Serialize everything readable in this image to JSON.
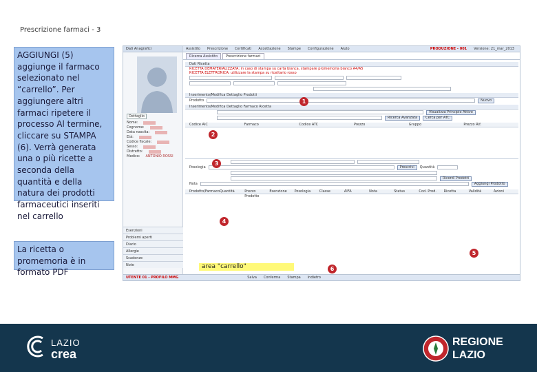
{
  "slide": {
    "title": "Prescrizione farmaci - 3"
  },
  "notes": {
    "main": "AGGIUNGI (5) aggiunge il farmaco selezionato nel “carrello”. Per aggiungere altri farmaci ripetere il processo Al termine, cliccare su STAMPA (6). Verrà generata una o più ricette a seconda della quantità e della natura dei prodotti farmaceutici inseriti nel carrello",
    "secondary": "La ricetta o promemoria è in formato PDF"
  },
  "app": {
    "left_header": "Dati Anagrafici",
    "photo_label": "Dettaglio",
    "patient_fields": [
      "Nome:",
      "Cognome:",
      "Data nascita:",
      "Età:",
      "Codice fiscale:",
      "Sesso:",
      "Distretto:",
      "Medico:"
    ],
    "medico_value": "ANTONIO ROSSI",
    "accordion": [
      "Esenzioni",
      "Problemi aperti",
      "Diario",
      "Allergie",
      "Scadenze",
      "Note"
    ],
    "topbar": {
      "items": [
        "Assistito",
        "Prescrizione",
        "Certificati",
        "Accettazione",
        "Stampe",
        "Configurazione",
        "Aiuto"
      ],
      "env": "PRODUZIONE - 001",
      "version": "Versione: 21_mar_2013"
    },
    "tabs": [
      "Ricerca Assistito",
      "Prescrizione farmaci"
    ],
    "sections": {
      "ricetta": "Dati Ricetta",
      "warn1": "RICETTA DEMATERIALIZZATA: in caso di stampa su carta bianca, stampare promemoria bianco A4/A5",
      "warn2": "RICETTA ELETTRONICA: utilizzare la stampa su ricettario rosso",
      "inserimento": "Inserimento/Modifica Dettaglio Prodotti",
      "farmaco": "Inserimento/Modifica Dettaglio Farmaco Ricetta",
      "campo_prodotto": "Prodotto",
      "btn_nuovo": "Nuovo",
      "btn_pa": "Visualizza Principio Attivo",
      "btn_ricerca": "Ricerca Avanzata",
      "btn_cerca_atc": "Cerca per ATC",
      "posologia": "Posologia",
      "quantita": "Quantità",
      "nota": "Nota",
      "btn_prescrivi": "Prescrivi",
      "btn_ricordi": "Ricordi Prodotti",
      "btn_aggiungi": "Aggiungi Prodotto"
    },
    "table_cols": [
      "Prodotto/Farmaco",
      "Quantità",
      "Prezzo Prodotto",
      "Esenzione",
      "Posologia",
      "Classe",
      "AIFA",
      "Nota",
      "Status",
      "Cod. Prod.",
      "Ricetta",
      "Validità",
      "Azioni"
    ],
    "cart_label": "area \"carrello\"",
    "bottom": {
      "user": "UTENTE 01 - PROFILO MMG",
      "actions": [
        "Salva",
        "Conferma",
        "Stampa",
        "Indietro"
      ]
    },
    "markers": [
      "1",
      "2",
      "3",
      "4",
      "5",
      "6"
    ]
  },
  "footer": {
    "lazio_crea_top": "LAZIO",
    "lazio_crea_bottom": "crea",
    "regione_top": "REGIONE",
    "regione_bottom": "LAZIO"
  },
  "colors": {
    "note_bg": "#a6c5ee",
    "marker": "#c0262c",
    "cart": "#fff978",
    "footer": "#14364d"
  }
}
